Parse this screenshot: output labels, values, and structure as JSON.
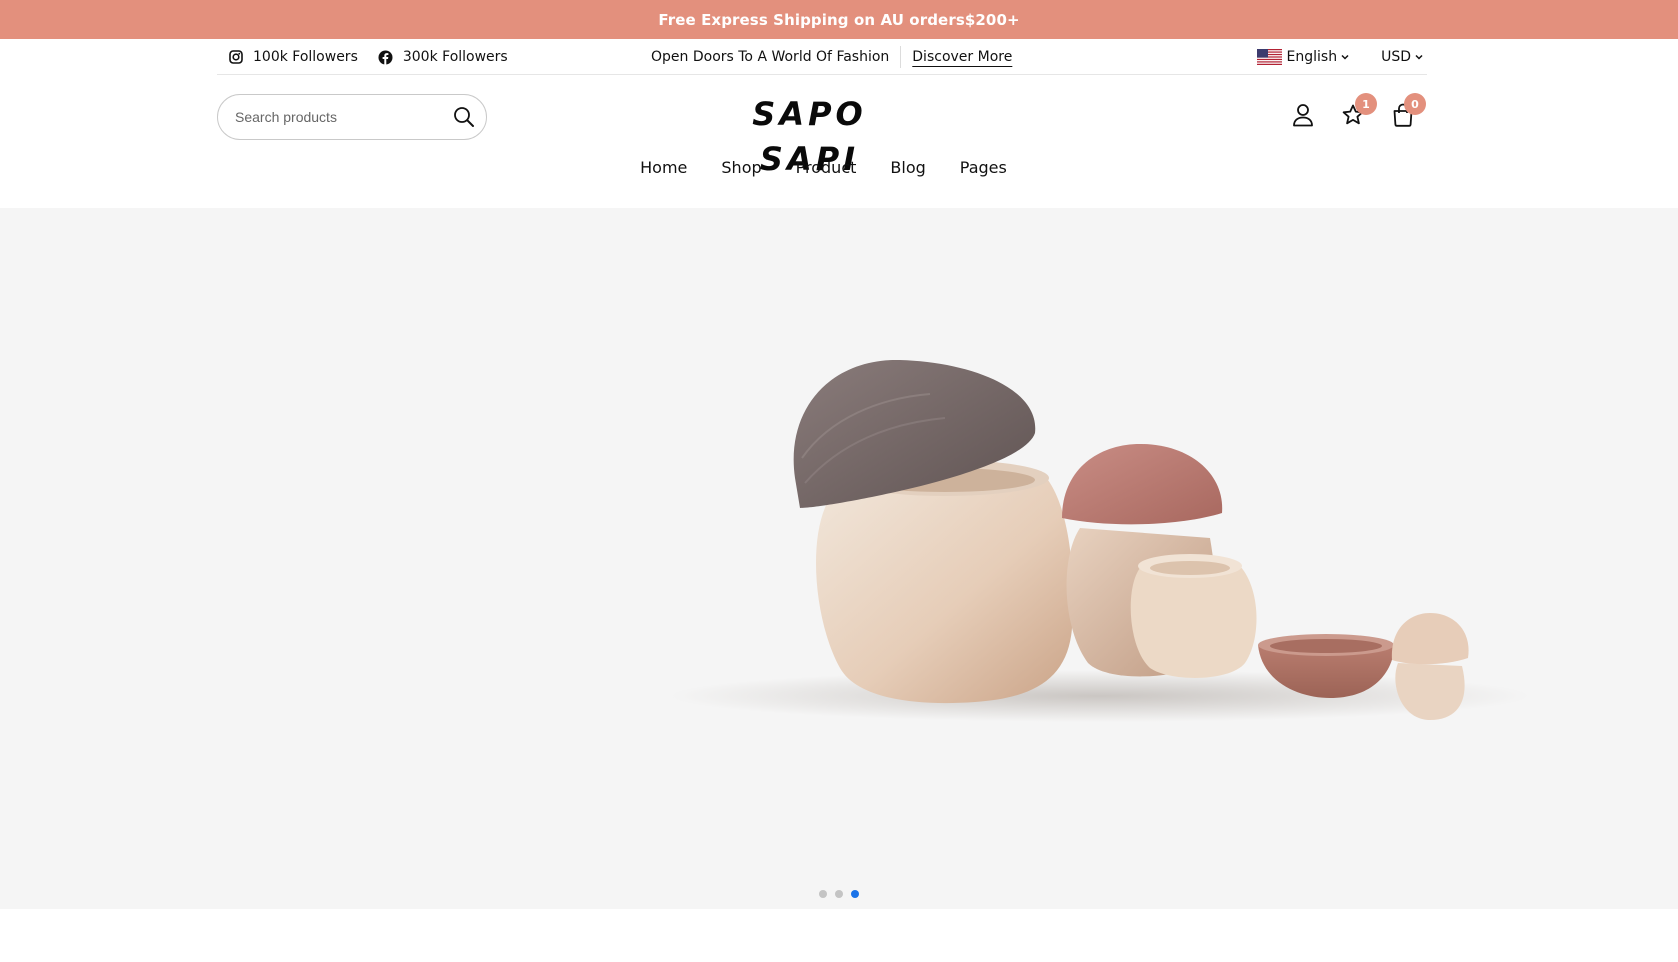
{
  "announcement": {
    "text": "Free Express Shipping on AU orders$200+"
  },
  "topbar": {
    "instagram": {
      "icon": "instagram-icon",
      "label": "100k Followers"
    },
    "facebook": {
      "icon": "facebook-icon",
      "label": "300k Followers"
    },
    "promo_text": "Open Doors To A World Of Fashion",
    "promo_link": "Discover More",
    "language": {
      "flag": "us-flag-icon",
      "label": "English"
    },
    "currency": "USD"
  },
  "header": {
    "search": {
      "placeholder": "Search products",
      "value": ""
    },
    "logo": "SAPO SAPI",
    "account_icon": "user-icon",
    "wishlist": {
      "icon": "star-icon",
      "count": "1"
    },
    "cart": {
      "icon": "shopping-bag-icon",
      "count": "0"
    }
  },
  "nav": {
    "items": [
      {
        "label": "Home"
      },
      {
        "label": "Shop"
      },
      {
        "label": "Product"
      },
      {
        "label": "Blog"
      },
      {
        "label": "Pages"
      }
    ]
  },
  "slider": {
    "total_slides": 3,
    "active_slide": 3
  },
  "colors": {
    "accent": "#e3907d",
    "hero_bg": "#f5f5f5",
    "active_dot": "#1a73e8"
  }
}
